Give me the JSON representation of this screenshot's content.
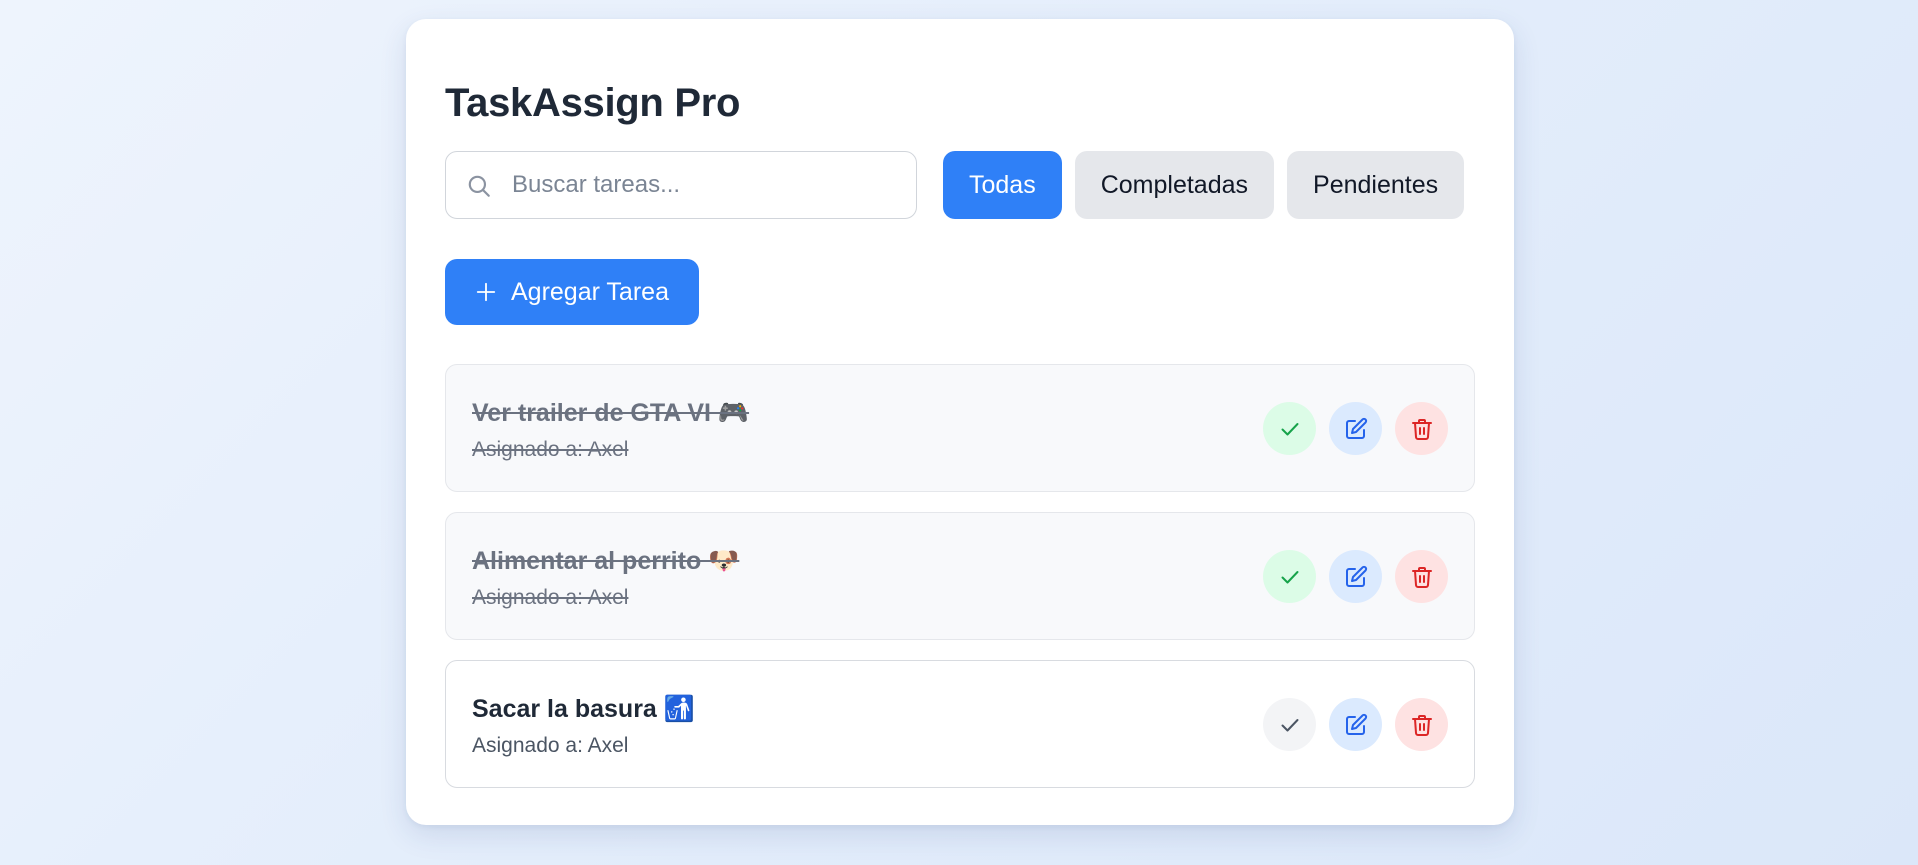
{
  "app": {
    "title": "TaskAssign Pro"
  },
  "search": {
    "placeholder": "Buscar tareas...",
    "value": ""
  },
  "filters": [
    {
      "label": "Todas",
      "active": true
    },
    {
      "label": "Completadas",
      "active": false
    },
    {
      "label": "Pendientes",
      "active": false
    }
  ],
  "add_button": {
    "label": "Agregar Tarea",
    "icon": "plus-icon"
  },
  "tasks": [
    {
      "title": "Ver trailer de GTA VI 🎮",
      "assignee": "Asignado a: Axel",
      "completed": true
    },
    {
      "title": "Alimentar al perrito 🐶",
      "assignee": "Asignado a: Axel",
      "completed": true
    },
    {
      "title": "Sacar la basura 🚮",
      "assignee": "Asignado a: Axel",
      "completed": false
    }
  ],
  "task_actions": [
    "check-icon",
    "edit-icon",
    "trash-icon"
  ],
  "colors": {
    "accent": "#2f80f7",
    "success": "#16a34a",
    "success_bg": "#dcfce7",
    "edit": "#2563eb",
    "edit_bg": "#dbeafe",
    "danger": "#dc2626",
    "danger_bg": "#fee2e2"
  }
}
